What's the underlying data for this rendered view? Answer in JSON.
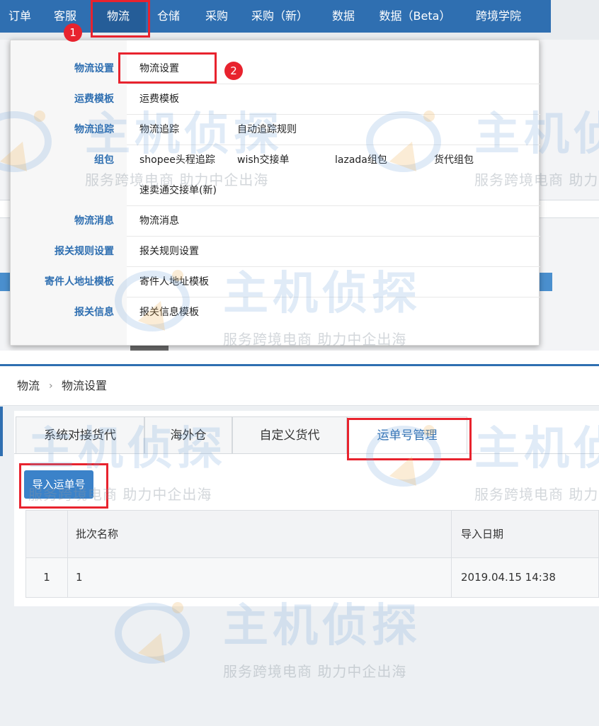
{
  "nav": {
    "items": [
      "订单",
      "客服",
      "物流",
      "仓储",
      "采购",
      "采购（新）",
      "数据",
      "数据（Beta）",
      "跨境学院"
    ],
    "active_index": 2,
    "steps": [
      "1",
      "2"
    ]
  },
  "dropdown": {
    "rows": [
      {
        "category": "物流设置",
        "links": [
          "物流设置"
        ]
      },
      {
        "category": "运费模板",
        "links": [
          "运费模板"
        ]
      },
      {
        "category": "物流追踪",
        "links": [
          "物流追踪",
          "自动追踪规则"
        ]
      },
      {
        "category": "组包",
        "links": [
          "shopee头程追踪",
          "wish交接单",
          "lazada组包",
          "货代组包"
        ]
      },
      {
        "category": "",
        "links": [
          "速卖通交接单(新)"
        ]
      },
      {
        "category": "物流消息",
        "links": [
          "物流消息"
        ]
      },
      {
        "category": "报关规则设置",
        "links": [
          "报关规则设置"
        ]
      },
      {
        "category": "寄件人地址模板",
        "links": [
          "寄件人地址模板"
        ]
      },
      {
        "category": "报关信息",
        "links": [
          "报关信息模板"
        ]
      }
    ]
  },
  "breadcrumb": {
    "items": [
      "物流",
      "物流设置"
    ],
    "separator": "›"
  },
  "tabs": [
    "系统对接货代",
    "海外仓",
    "自定义货代",
    "运单号管理"
  ],
  "active_tab": 3,
  "toolbar": {
    "import_label": "导入运单号"
  },
  "table": {
    "columns": [
      "",
      "批次名称",
      "导入日期"
    ],
    "rows": [
      [
        "1",
        "1",
        "2019.04.15 14:38"
      ]
    ]
  },
  "watermark": {
    "brand": "主机侦探",
    "slogan": "服务跨境电商 助力中企出海"
  },
  "colors": {
    "nav_bg": "#2f6fb1",
    "accent": "#2f6fb1",
    "highlight": "#e8232e",
    "button": "#3b82c9"
  }
}
